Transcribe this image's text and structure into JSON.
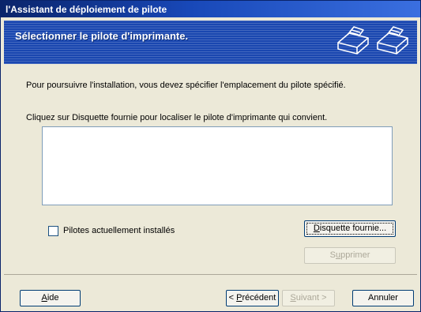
{
  "window": {
    "title": "l'Assistant de déploiement de pilote"
  },
  "banner": {
    "title": "Sélectionner le pilote d'imprimante.",
    "icons": [
      "printer-icon",
      "printer-icon"
    ]
  },
  "content": {
    "text_location": "Pour poursuivre l'installation, vous devez spécifier l'emplacement du pilote spécifié.",
    "text_disk": "Cliquez sur Disquette fournie pour localiser le pilote d'imprimante qui convient.",
    "driver_list": [],
    "checkbox": {
      "label": "Pilotes actuellement installés",
      "checked": false
    }
  },
  "buttons": {
    "have_disk": {
      "pre": "",
      "key": "D",
      "post": "isquette fournie..."
    },
    "delete": {
      "pre": "S",
      "key": "u",
      "post": "pprimer"
    },
    "help": {
      "pre": "",
      "key": "A",
      "post": "ide"
    },
    "previous": {
      "pre": "< ",
      "key": "P",
      "post": "récédent"
    },
    "next": {
      "pre": "",
      "key": "S",
      "post": "uivant >"
    },
    "cancel": {
      "label": "Annuler"
    }
  },
  "colors": {
    "title_bar": "#0a246a",
    "banner": "#1a47b0",
    "dialog_bg": "#ece9d8",
    "disabled_text": "#aca899"
  }
}
